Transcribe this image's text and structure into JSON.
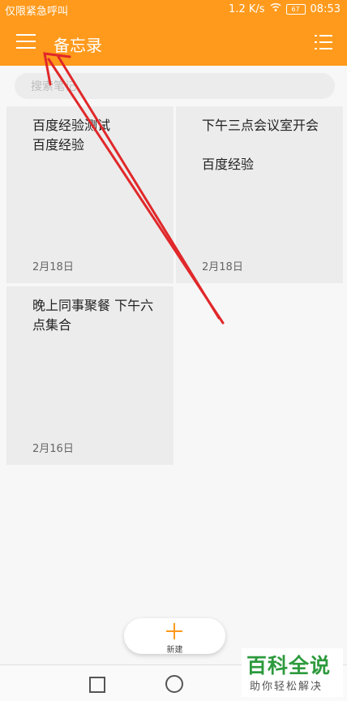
{
  "status_bar": {
    "left_text": "仅限紧急呼叫",
    "speed": "1.2 K/s",
    "battery": "67",
    "time": "08:53"
  },
  "app_bar": {
    "title": "备忘录",
    "menu_icon": "hamburger-menu-icon",
    "view_icon": "list-view-icon",
    "color": "#ff9a1c"
  },
  "search": {
    "placeholder": "搜索笔记",
    "value": ""
  },
  "notes": [
    {
      "text": "百度经验测试\n百度经验",
      "date": "2月18日"
    },
    {
      "text": "下午三点会议室开会\n\n百度经验",
      "date": "2月18日"
    },
    {
      "text": "晚上同事聚餐 下午六点集合",
      "date": "2月16日"
    }
  ],
  "new_button": {
    "label": "新建",
    "icon": "plus-icon"
  },
  "watermark": {
    "main": "百科全说",
    "sub": "助你轻松解决"
  },
  "annotation": {
    "color": "#e0282a"
  }
}
